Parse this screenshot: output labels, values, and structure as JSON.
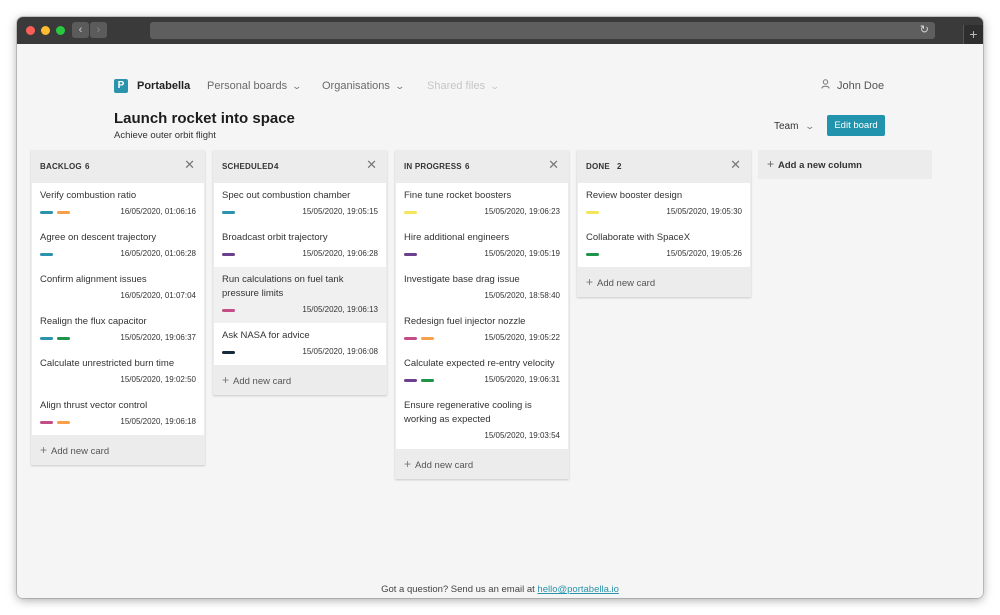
{
  "browser": {
    "back_label": "‹",
    "forward_label": "›",
    "reload_icon": "reload-icon",
    "newtab_label": "+"
  },
  "header": {
    "logo_letter": "P",
    "brand": "Portabella",
    "nav": [
      {
        "label": "Personal boards",
        "disabled": false
      },
      {
        "label": "Organisations",
        "disabled": false
      },
      {
        "label": "Shared files",
        "disabled": true
      }
    ],
    "user": "John Doe"
  },
  "board": {
    "title": "Launch rocket into space",
    "subtitle": "Achieve outer orbit flight",
    "team_label": "Team",
    "edit_label": "Edit board"
  },
  "colors": {
    "accent": "#2193ad",
    "tag_teal": "#2b93ab",
    "tag_orange": "#f7a04b",
    "tag_green": "#1f9448",
    "tag_purple": "#6b3f8e",
    "tag_pink": "#c44d86",
    "tag_yellow": "#f4e55b",
    "tag_navy": "#172a3a"
  },
  "columns": [
    {
      "title": "BACKLOG",
      "count": "6",
      "cards": [
        {
          "title": "Verify combustion ratio",
          "tags": [
            "teal",
            "orange"
          ],
          "time": "16/05/2020, 01:06:16"
        },
        {
          "title": "Agree on descent trajectory",
          "tags": [
            "teal"
          ],
          "time": "16/05/2020, 01:06:28"
        },
        {
          "title": "Confirm alignment issues",
          "tags": [],
          "time": "16/05/2020, 01:07:04"
        },
        {
          "title": "Realign the flux capacitor",
          "tags": [
            "teal",
            "green"
          ],
          "time": "15/05/2020, 19:06:37"
        },
        {
          "title": "Calculate unrestricted burn time",
          "tags": [],
          "time": "15/05/2020, 19:02:50"
        },
        {
          "title": "Align thrust vector control",
          "tags": [
            "pink",
            "orange"
          ],
          "time": "15/05/2020, 19:06:18"
        }
      ],
      "add_label": "Add new card"
    },
    {
      "title": "SCHEDULED",
      "count": "4",
      "cards": [
        {
          "title": "Spec out combustion chamber",
          "tags": [
            "teal"
          ],
          "time": "15/05/2020, 19:05:15"
        },
        {
          "title": "Broadcast orbit trajectory",
          "tags": [
            "purple"
          ],
          "time": "15/05/2020, 19:06:28"
        },
        {
          "title": "Run calculations on fuel tank pressure limits",
          "tags": [
            "pink"
          ],
          "time": "15/05/2020, 19:06:13",
          "highlight": true
        },
        {
          "title": "Ask NASA for advice",
          "tags": [
            "navy"
          ],
          "time": "15/05/2020, 19:06:08"
        }
      ],
      "add_label": "Add new card"
    },
    {
      "title": "IN PROGRESS",
      "count": "6",
      "cards": [
        {
          "title": "Fine tune rocket boosters",
          "tags": [
            "yellow"
          ],
          "time": "15/05/2020, 19:06:23"
        },
        {
          "title": "Hire additional engineers",
          "tags": [
            "purple"
          ],
          "time": "15/05/2020, 19:05:19"
        },
        {
          "title": "Investigate base drag issue",
          "tags": [],
          "time": "15/05/2020, 18:58:40"
        },
        {
          "title": "Redesign fuel injector nozzle",
          "tags": [
            "pink",
            "orange"
          ],
          "time": "15/05/2020, 19:05:22"
        },
        {
          "title": "Calculate expected re-entry velocity",
          "tags": [
            "purple",
            "green"
          ],
          "time": "15/05/2020, 19:06:31"
        },
        {
          "title": "Ensure regenerative cooling is working as expected",
          "tags": [],
          "time": "15/05/2020, 19:03:54"
        }
      ],
      "add_label": "Add new card"
    },
    {
      "title": "DONE",
      "count": "2",
      "cards": [
        {
          "title": "Review booster design",
          "tags": [
            "yellow"
          ],
          "time": "15/05/2020, 19:05:30"
        },
        {
          "title": "Collaborate with SpaceX",
          "tags": [
            "green"
          ],
          "time": "15/05/2020, 19:05:26"
        }
      ],
      "add_label": "Add new card"
    }
  ],
  "add_column_label": "Add a new column",
  "footer": {
    "text": "Got a question? Send us an email at ",
    "email": "hello@portabella.io"
  }
}
